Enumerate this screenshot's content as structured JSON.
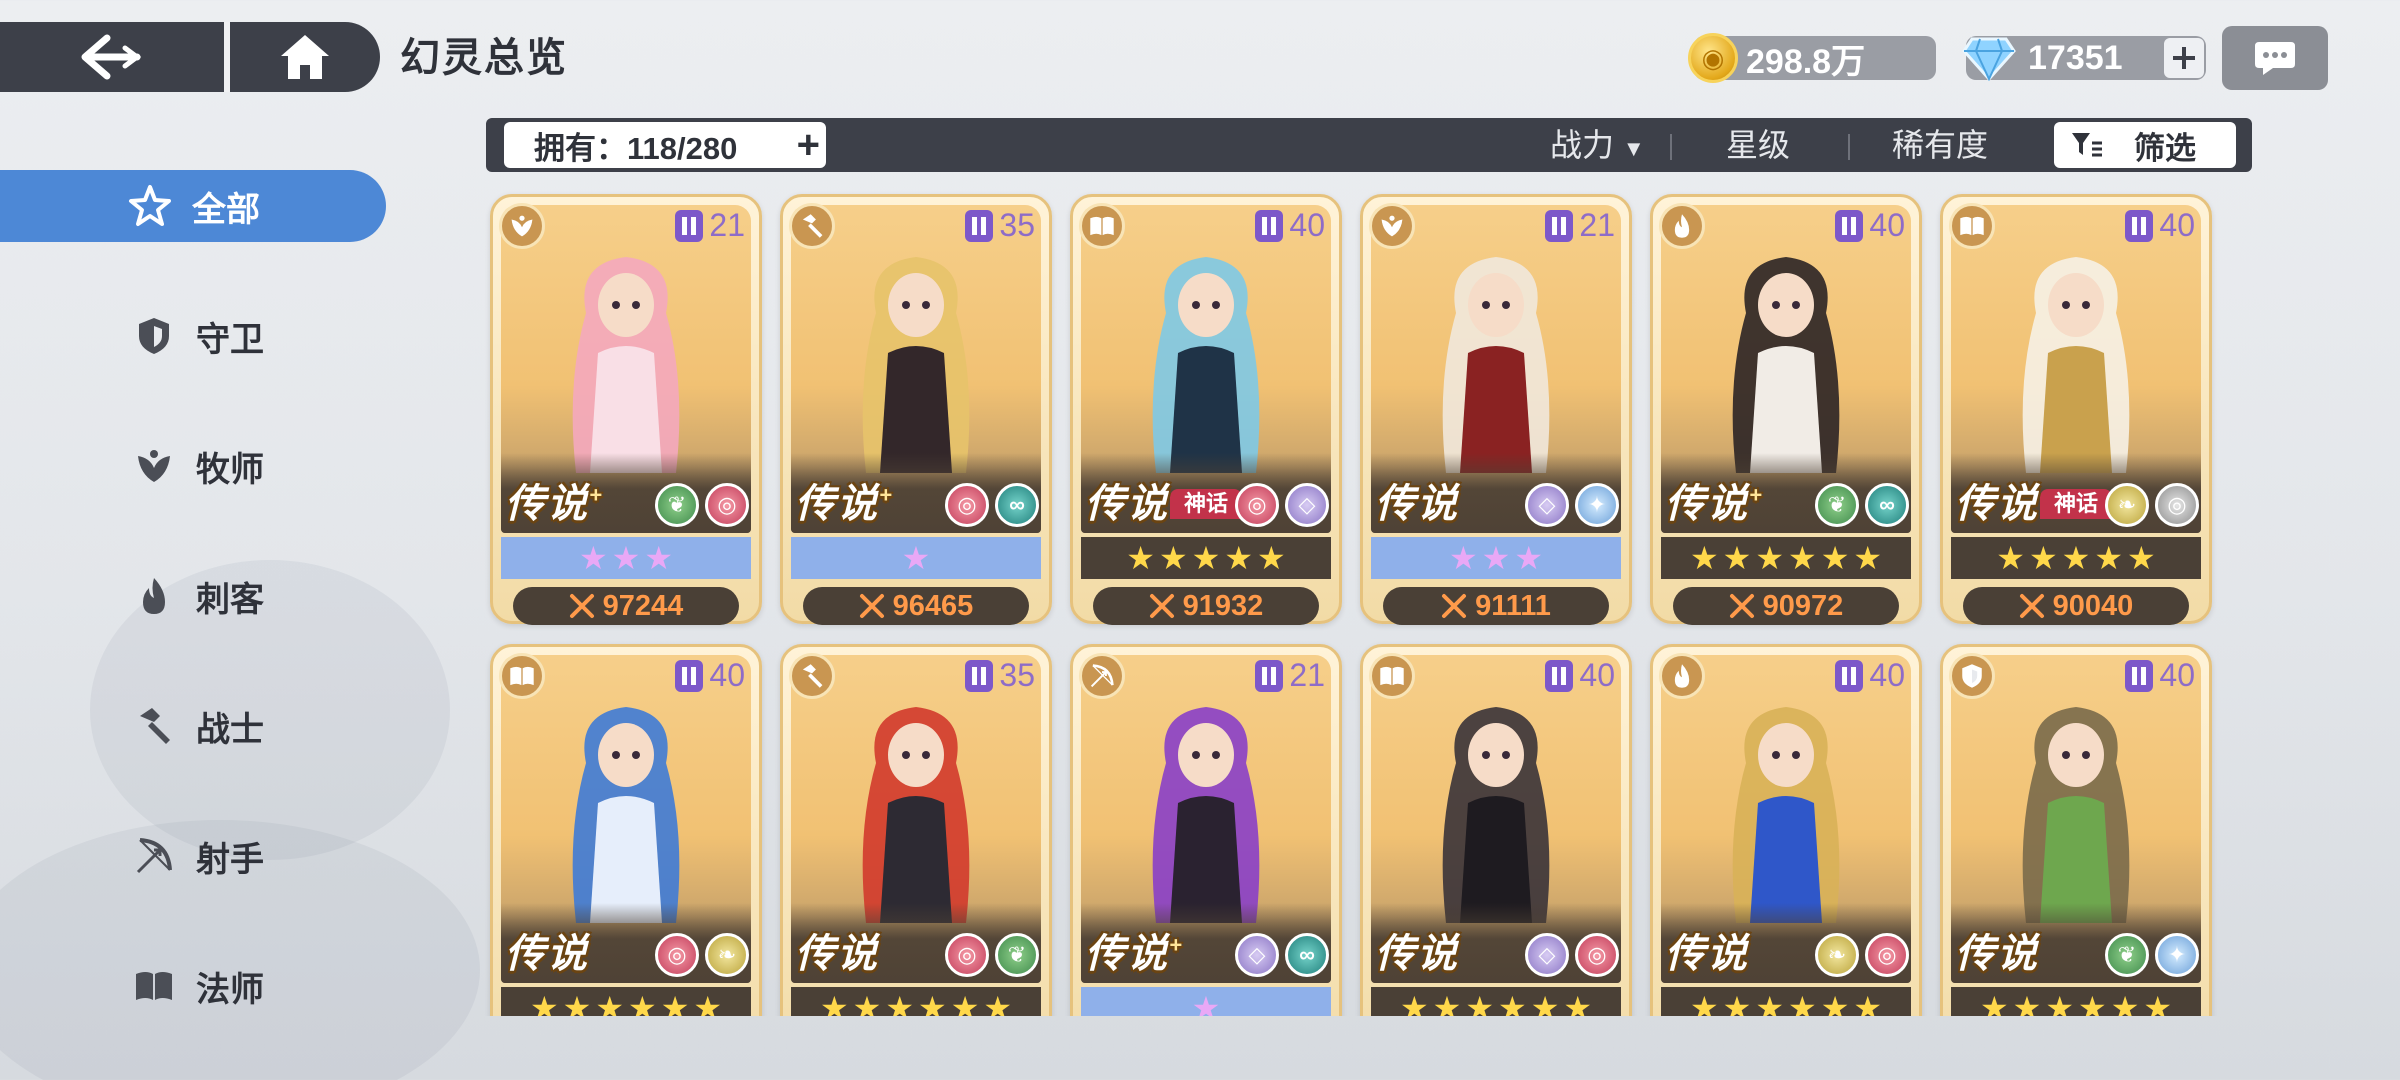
{
  "header": {
    "title": "幻灵总览",
    "gold": "298.8万",
    "gems": "17351"
  },
  "sidebar": {
    "items": [
      {
        "label": "全部",
        "icon": "star-icon",
        "active": true
      },
      {
        "label": "守卫",
        "icon": "shield-icon",
        "active": false
      },
      {
        "label": "牧师",
        "icon": "leaf-icon",
        "active": false
      },
      {
        "label": "刺客",
        "icon": "flame-icon",
        "active": false
      },
      {
        "label": "战士",
        "icon": "hammer-icon",
        "active": false
      },
      {
        "label": "射手",
        "icon": "bow-icon",
        "active": false
      },
      {
        "label": "法师",
        "icon": "book-icon",
        "active": false
      }
    ]
  },
  "filter": {
    "owned": "拥有：118/280",
    "sort_power": "战力",
    "sort_arrow": "▼",
    "sort_star": "星级",
    "sort_rarity": "稀有度",
    "screen": "筛选"
  },
  "cards": [
    {
      "role": "leaf-icon",
      "level": "21",
      "rarity": "传说",
      "plus": true,
      "myth": "",
      "elements": [
        "nature",
        "flame"
      ],
      "stars": 3,
      "star_color": "purple",
      "power": "97244",
      "palette": [
        "#f4a9be",
        "#f9dfe6"
      ]
    },
    {
      "role": "hammer-icon",
      "level": "35",
      "rarity": "传说",
      "plus": true,
      "myth": "",
      "elements": [
        "flame",
        "tide"
      ],
      "stars": 1,
      "star_color": "purple",
      "power": "96465",
      "palette": [
        "#e7c36a",
        "#33272a"
      ]
    },
    {
      "role": "book-icon",
      "level": "40",
      "rarity": "传说",
      "plus": false,
      "myth": "神话",
      "elements": [
        "flame",
        "void"
      ],
      "stars": 5,
      "star_color": "gold",
      "power": "91932",
      "palette": [
        "#7ec9e6",
        "#1f3347"
      ]
    },
    {
      "role": "leaf-icon",
      "level": "21",
      "rarity": "传说",
      "plus": false,
      "myth": "",
      "elements": [
        "void",
        "frost"
      ],
      "stars": 3,
      "star_color": "purple",
      "power": "91111",
      "palette": [
        "#f1e8dc",
        "#8a2222"
      ]
    },
    {
      "role": "flame-icon",
      "level": "40",
      "rarity": "传说",
      "plus": true,
      "myth": "",
      "elements": [
        "nature",
        "tide"
      ],
      "stars": 6,
      "star_color": "gold",
      "power": "90972",
      "palette": [
        "#2b2325",
        "#f1ece6"
      ]
    },
    {
      "role": "book-icon",
      "level": "40",
      "rarity": "传说",
      "plus": false,
      "myth": "神话",
      "elements": [
        "gale",
        "vortex"
      ],
      "stars": 5,
      "star_color": "gold",
      "power": "90040",
      "palette": [
        "#f6f1e6",
        "#c9a14d"
      ]
    },
    {
      "role": "book-icon",
      "level": "40",
      "rarity": "传说",
      "plus": false,
      "myth": "",
      "elements": [
        "flame",
        "gale"
      ],
      "stars": 6,
      "star_color": "gold",
      "power": "",
      "palette": [
        "#3f7bd6",
        "#e6eefb"
      ]
    },
    {
      "role": "hammer-icon",
      "level": "35",
      "rarity": "传说",
      "plus": false,
      "myth": "",
      "elements": [
        "flame",
        "nature"
      ],
      "stars": 6,
      "star_color": "gold",
      "power": "",
      "palette": [
        "#d23a2c",
        "#2d2a33"
      ]
    },
    {
      "role": "bow-icon",
      "level": "21",
      "rarity": "传说",
      "plus": true,
      "myth": "",
      "elements": [
        "void",
        "tide"
      ],
      "stars": 1,
      "star_color": "purple",
      "power": "",
      "palette": [
        "#8a3fc8",
        "#2a2230"
      ]
    },
    {
      "role": "book-icon",
      "level": "40",
      "rarity": "传说",
      "plus": false,
      "myth": "",
      "elements": [
        "void",
        "flame"
      ],
      "stars": 6,
      "star_color": "gold",
      "power": "",
      "palette": [
        "#3a3338",
        "#1e1b20"
      ]
    },
    {
      "role": "flame-icon",
      "level": "40",
      "rarity": "传说",
      "plus": false,
      "myth": "",
      "elements": [
        "gale",
        "flame"
      ],
      "stars": 6,
      "star_color": "gold",
      "power": "",
      "palette": [
        "#d8b158",
        "#2f57c9"
      ]
    },
    {
      "role": "shield-icon",
      "level": "40",
      "rarity": "传说",
      "plus": false,
      "myth": "",
      "elements": [
        "nature",
        "frost"
      ],
      "stars": 6,
      "star_color": "gold",
      "power": "",
      "palette": [
        "#7a6a4a",
        "#6ea74e"
      ]
    }
  ],
  "colors": {
    "accent": "#4d88d6",
    "bar": "#3d4049",
    "power": "#ff9a4a"
  }
}
